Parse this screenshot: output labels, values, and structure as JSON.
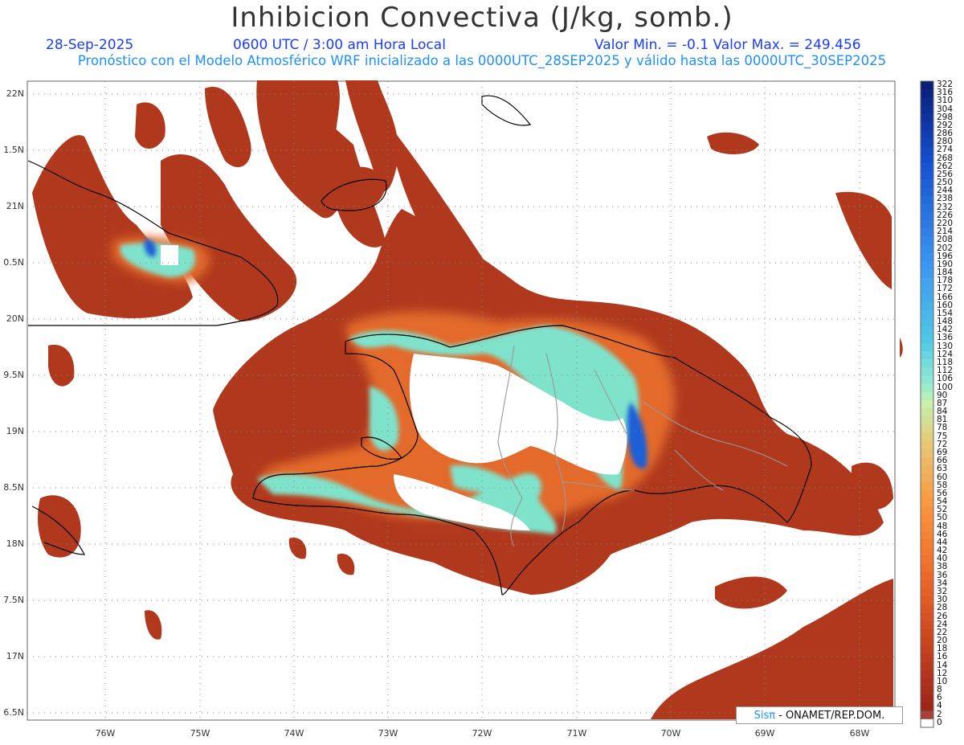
{
  "header": {
    "title": "Inhibicion Convectiva (J/kg, somb.)",
    "date": "28-Sep-2025",
    "time": "0600 UTC / 3:00 am Hora Local",
    "minmax": "Valor Min. = -0.1  Valor Max. = 249.456",
    "subtitle": "Pronóstico con el Modelo Atmosférico WRF inicializado a las 0000UTC_28SEP2025 y válido hasta las  0000UTC_30SEP2025"
  },
  "lat_labels": [
    "22N",
    "1.5N",
    "21N",
    "0.5N",
    "20N",
    "9.5N",
    "19N",
    "8.5N",
    "18N",
    "7.5N",
    "17N",
    "6.5N"
  ],
  "lon_labels": [
    "76W",
    "75W",
    "74W",
    "73W",
    "72W",
    "71W",
    "70W",
    "69W",
    "68W"
  ],
  "colorbar": {
    "labels": [
      "322",
      "316",
      "310",
      "304",
      "298",
      "292",
      "286",
      "280",
      "274",
      "268",
      "262",
      "256",
      "250",
      "244",
      "238",
      "232",
      "226",
      "220",
      "214",
      "208",
      "202",
      "196",
      "190",
      "184",
      "178",
      "172",
      "166",
      "160",
      "154",
      "148",
      "142",
      "136",
      "130",
      "124",
      "118",
      "112",
      "106",
      "100",
      "90",
      "87",
      "84",
      "81",
      "78",
      "75",
      "72",
      "69",
      "66",
      "63",
      "60",
      "58",
      "56",
      "54",
      "52",
      "50",
      "48",
      "46",
      "44",
      "42",
      "40",
      "38",
      "36",
      "34",
      "32",
      "30",
      "28",
      "26",
      "24",
      "22",
      "20",
      "18",
      "16",
      "14",
      "12",
      "10",
      "8",
      "6",
      "4",
      "2",
      "0"
    ]
  },
  "credit": {
    "logo": "Sisπ",
    "text": "- ONAMET/REP.DOM."
  },
  "colors": {
    "low": "#b33a1e",
    "mid": "#e8742c",
    "high": "#7fe0c8",
    "max": "#1f5fd6"
  }
}
